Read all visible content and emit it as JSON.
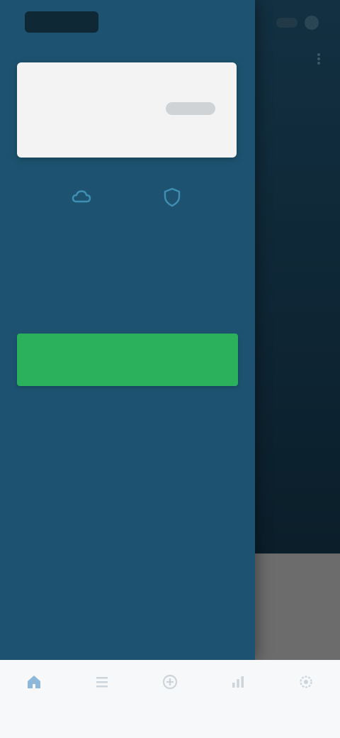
{
  "colors": {
    "drawer_bg": "#1d5370",
    "backdrop": "#0e2230",
    "card_bg": "#f3f3f3",
    "primary_button": "#2bb05c",
    "icon_accent": "#3f8fb4",
    "nav_bg": "#f6f8fa",
    "nav_active": "#8fb8d8",
    "nav_inactive": "#cdd5db"
  },
  "header": {
    "logo_icon": "brand-logo-icon",
    "controls": [
      "toggle-icon",
      "avatar-icon"
    ],
    "menu_icon": "kebab-menu-icon"
  },
  "drawer": {
    "card": {
      "caption": "",
      "name": "",
      "detail": ""
    },
    "icons": [
      {
        "name": "cloud-icon"
      },
      {
        "name": "shield-icon"
      }
    ],
    "message": [
      "",
      ""
    ],
    "subtext": "",
    "primary_button_label": "",
    "footer_text": ""
  },
  "bottom_nav": {
    "items": [
      {
        "icon": "home-icon",
        "label": "",
        "active": true
      },
      {
        "icon": "list-icon",
        "label": "",
        "active": false
      },
      {
        "icon": "add-icon",
        "label": "",
        "active": false
      },
      {
        "icon": "chart-icon",
        "label": "",
        "active": false
      },
      {
        "icon": "settings-icon",
        "label": "",
        "active": false
      }
    ]
  }
}
